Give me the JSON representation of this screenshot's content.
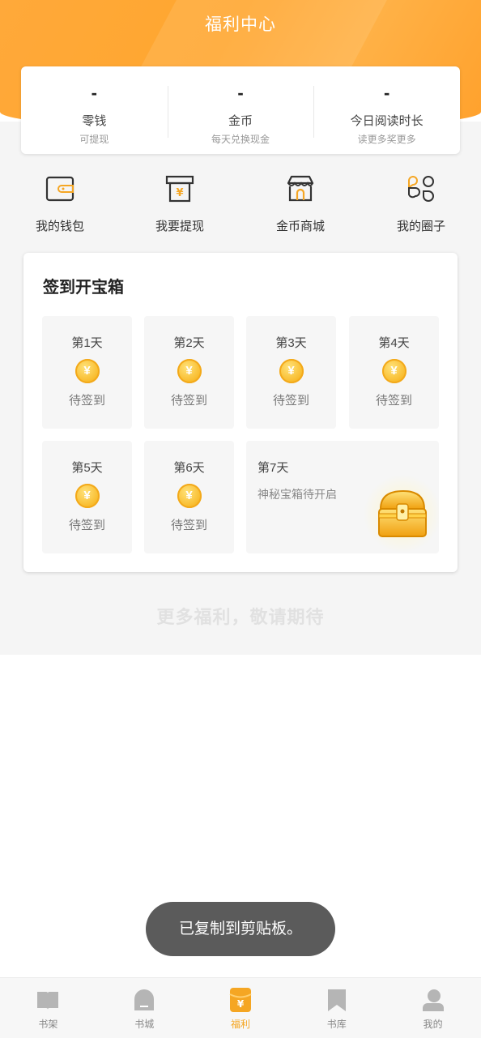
{
  "header": {
    "title": "福利中心"
  },
  "stats": [
    {
      "value": "-",
      "label": "零钱",
      "sub": "可提现"
    },
    {
      "value": "-",
      "label": "金币",
      "sub": "每天兑换现金"
    },
    {
      "value": "-",
      "label": "今日阅读时长",
      "sub": "读更多奖更多"
    }
  ],
  "shortcuts": [
    {
      "label": "我的钱包",
      "icon": "wallet-icon"
    },
    {
      "label": "我要提现",
      "icon": "withdraw-icon"
    },
    {
      "label": "金币商城",
      "icon": "store-icon"
    },
    {
      "label": "我的圈子",
      "icon": "circle-icon"
    }
  ],
  "signin": {
    "title": "签到开宝箱",
    "coin_symbol": "¥",
    "days": [
      {
        "day": "第1天",
        "status": "待签到"
      },
      {
        "day": "第2天",
        "status": "待签到"
      },
      {
        "day": "第3天",
        "status": "待签到"
      },
      {
        "day": "第4天",
        "status": "待签到"
      },
      {
        "day": "第5天",
        "status": "待签到"
      },
      {
        "day": "第6天",
        "status": "待签到"
      }
    ],
    "day7": {
      "day": "第7天",
      "desc": "神秘宝箱待开启"
    }
  },
  "more_text": "更多福利，敬请期待",
  "toast": "已复制到剪贴板。",
  "tabbar": [
    {
      "label": "书架",
      "icon": "bookshelf-icon",
      "active": false
    },
    {
      "label": "书城",
      "icon": "bookstore-icon",
      "active": false
    },
    {
      "label": "福利",
      "icon": "welfare-icon",
      "active": true
    },
    {
      "label": "书库",
      "icon": "library-icon",
      "active": false
    },
    {
      "label": "我的",
      "icon": "profile-icon",
      "active": false
    }
  ],
  "colors": {
    "accent": "#f5a623",
    "header": "#ffa93a"
  }
}
